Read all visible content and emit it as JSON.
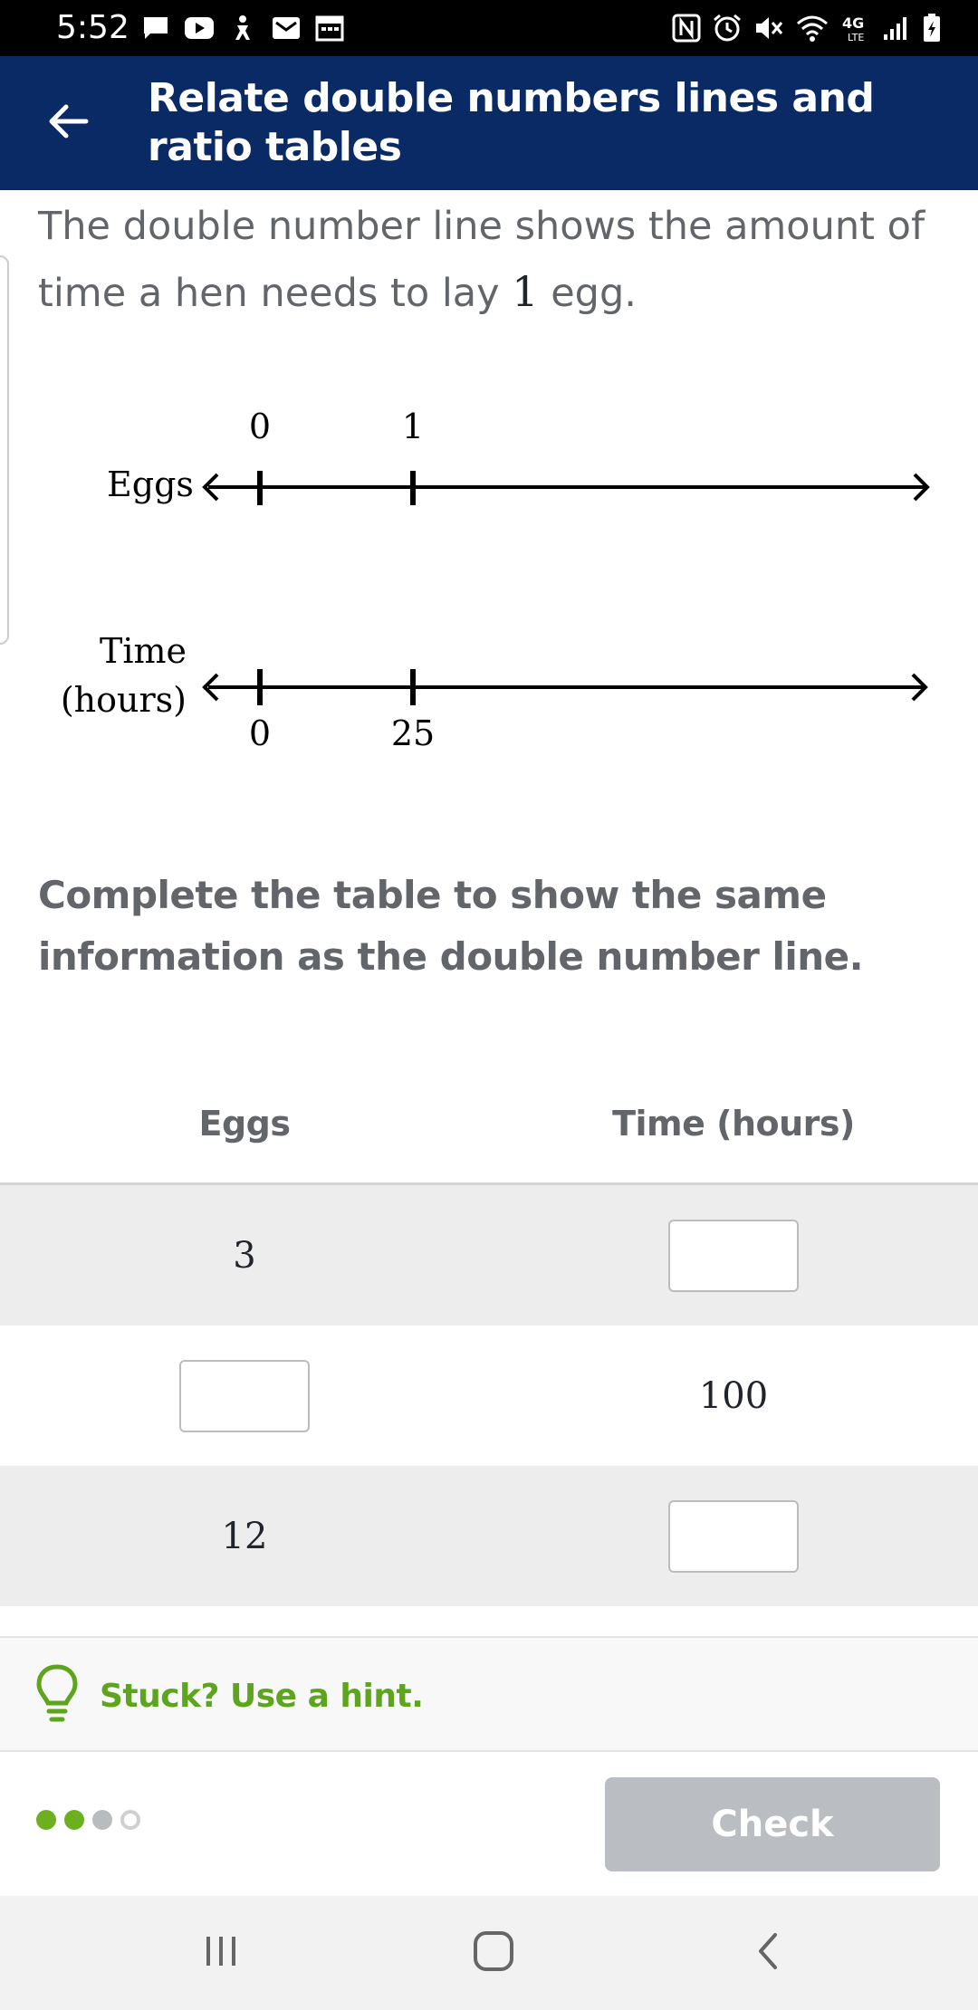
{
  "status_bar": {
    "time": "5:52",
    "left_icons": [
      "message-icon",
      "youtube-icon",
      "accessibility-icon",
      "email-icon",
      "calendar-icon"
    ],
    "right_icons": [
      "nfc-icon",
      "alarm-icon",
      "mute-icon",
      "wifi-icon",
      "network-4g-lte-icon",
      "signal-icon",
      "battery-icon"
    ]
  },
  "header": {
    "back_icon": "arrow-left-icon",
    "title": "Relate double numbers lines and ratio tables"
  },
  "problem": {
    "text_before": "The double number line shows the amount of time a hen needs to lay ",
    "number": "1",
    "text_after": " egg."
  },
  "number_line": {
    "top_label": "Eggs",
    "top_ticks": [
      "0",
      "1"
    ],
    "bottom_label_line1": "Time",
    "bottom_label_line2": "(hours)",
    "bottom_ticks": [
      "0",
      "25"
    ]
  },
  "prompt": "Complete the table to show the same information as the double number line.",
  "table": {
    "headers": [
      "Eggs",
      "Time (hours)"
    ],
    "rows": [
      {
        "eggs": "3",
        "time": ""
      },
      {
        "eggs": "",
        "time": "100"
      },
      {
        "eggs": "12",
        "time": ""
      }
    ]
  },
  "hint": {
    "icon": "lightbulb-icon",
    "label": "Stuck? Use a hint."
  },
  "progress": {
    "total": 4,
    "completed": 2,
    "current": 3,
    "colors": {
      "completed": "#6cb01f",
      "current": "#b9bcbf",
      "pending_border": "#cfcfcf"
    }
  },
  "check_button": {
    "label": "Check",
    "enabled": false
  },
  "nav_bar": {
    "icons": [
      "recent-apps-icon",
      "home-icon",
      "back-icon"
    ]
  },
  "colors": {
    "header_bg": "#0a2a66",
    "hint_green": "#5ea51e",
    "button_disabled": "#babec2"
  }
}
